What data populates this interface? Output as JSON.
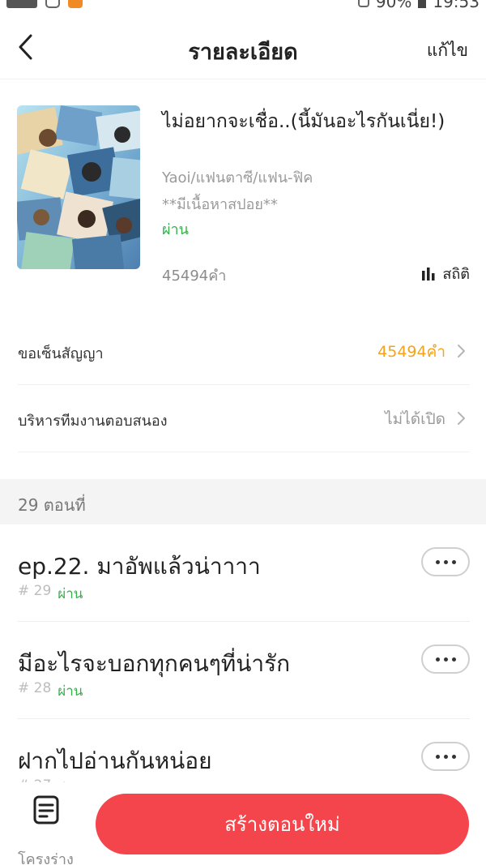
{
  "status_bar": {
    "battery": "90%",
    "time": "19:53",
    "app_badge": "TOON"
  },
  "nav": {
    "title": "รายละเอียด",
    "edit_label": "แก้ไข"
  },
  "book": {
    "title": "ไม่อยากจะเชื่อ..(นี้มันอะไรกันเนี่ย!)",
    "genre": "Yaoi/แฟนตาซี/แฟน-ฟิค",
    "note": "**มีเนื้อหาสปอย**",
    "status": "ผ่าน",
    "word_count": "45494คำ",
    "stats_label": "สถิติ"
  },
  "rows": {
    "contract_label": "ขอเซ็นสัญญา",
    "contract_value": "45494คำ",
    "team_label": "บริหารทีมงานตอบสนอง",
    "team_value": "ไม่ได้เปิด"
  },
  "episodes_header": "29 ตอนที่",
  "episodes": [
    {
      "title": "ep.22. มาอัพแล้วน่าาาา",
      "number": "# 29",
      "status": "ผ่าน"
    },
    {
      "title": "มีอะไรจะบอกทุกคนๆที่น่ารัก",
      "number": "# 28",
      "status": "ผ่าน"
    },
    {
      "title": "ฝากไปอ่านกันหน่อย",
      "number": "# 27",
      "status": "ผ่าน"
    }
  ],
  "bottom": {
    "draft_label": "โครงร่าง",
    "create_button": "สร้างตอนใหม่"
  },
  "colors": {
    "accent_red": "#f5454c",
    "status_green": "#33b24a",
    "contract_orange": "#f5a31a",
    "muted_gray": "#9a9a9a"
  },
  "icons": [
    "back-chevron-icon",
    "bar-chart-icon",
    "chevron-right-icon",
    "more-dots-icon",
    "draft-document-icon"
  ]
}
